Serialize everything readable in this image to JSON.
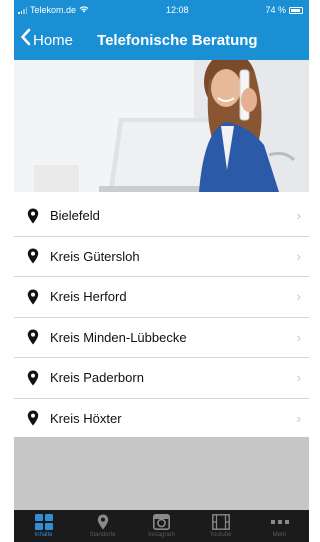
{
  "status_bar": {
    "carrier": "Telekom.de",
    "time": "12:08",
    "battery": "74 %"
  },
  "nav": {
    "back_label": "Home",
    "title": "Telefonische Beratung"
  },
  "hero": {
    "icon": "woman-on-phone-photo"
  },
  "locations": [
    {
      "label": "Bielefeld"
    },
    {
      "label": "Kreis Gütersloh"
    },
    {
      "label": "Kreis Herford"
    },
    {
      "label": "Kreis Minden-Lübbecke"
    },
    {
      "label": "Kreis Paderborn"
    },
    {
      "label": "Kreis Höxter"
    }
  ],
  "tabs": [
    {
      "label": "Inhalte",
      "icon": "grid-icon",
      "active": true
    },
    {
      "label": "Standorte",
      "icon": "location-pin-icon"
    },
    {
      "label": "Instagram",
      "icon": "instagram-icon"
    },
    {
      "label": "Youtube",
      "icon": "film-icon"
    },
    {
      "label": "Mehr",
      "icon": "more-dots-icon"
    }
  ],
  "colors": {
    "accent": "#1a8fd3",
    "tab_bar": "#1b1b1b",
    "active_tab": "#2f8ed4",
    "chevron": "#c3c3c3"
  }
}
